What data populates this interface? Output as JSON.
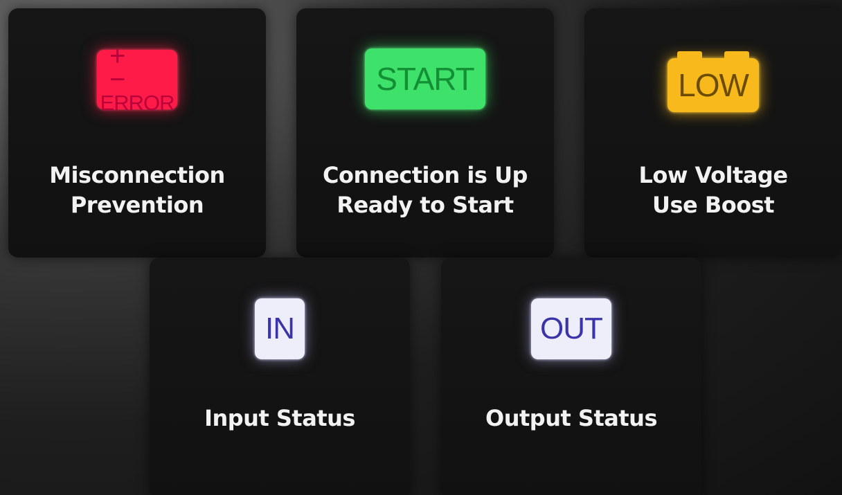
{
  "cards": [
    {
      "indicator": {
        "icon": "plus-minus-icon",
        "signs": "+ −",
        "text": "ERROR",
        "color": "#ff1b47"
      },
      "label_lines": [
        "Misconnection",
        "Prevention"
      ]
    },
    {
      "indicator": {
        "text": "START",
        "color": "#3ee26a"
      },
      "label_lines": [
        "Connection is Up",
        "Ready to Start"
      ]
    },
    {
      "indicator": {
        "icon": "battery-icon",
        "text": "LOW",
        "color": "#f7b91c"
      },
      "label_lines": [
        "Low Voltage",
        "Use Boost"
      ]
    },
    {
      "indicator": {
        "text": "IN",
        "color": "#eeeefb"
      },
      "label_lines": [
        "Input Status"
      ]
    },
    {
      "indicator": {
        "text": "OUT",
        "color": "#eeeefb"
      },
      "label_lines": [
        "Output Status"
      ]
    }
  ]
}
